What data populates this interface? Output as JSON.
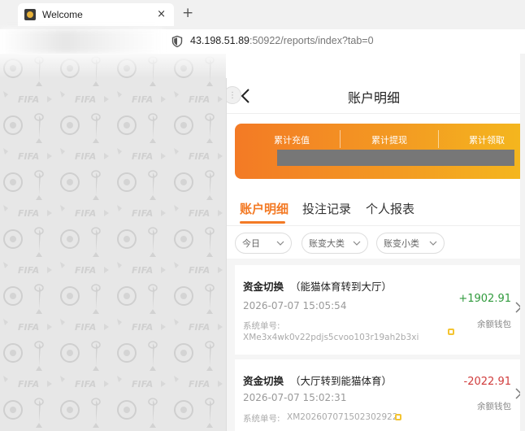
{
  "browser": {
    "tab_title": "Welcome",
    "close_glyph": "×",
    "new_tab_glyph": "+",
    "url_host": "43.198.51.89",
    "url_rest": ":50922/reports/index?tab=0"
  },
  "header": {
    "back_glyph": "<",
    "title": "账户明细"
  },
  "summary": {
    "stats": [
      "累计充值",
      "累计提现",
      "累计领取"
    ]
  },
  "tabs": [
    "账户明细",
    "投注记录",
    "个人报表"
  ],
  "filters": [
    "今日",
    "账变大类",
    "账变小类"
  ],
  "records": [
    {
      "title": "资金切换",
      "detail": "（能猫体育转到大厅）",
      "time": "2026-07-07 15:05:54",
      "no_label": "系统单号:",
      "no": "XMe3x4wk0v22pdjs5cvoo103r19ah2b3xi",
      "amount": "+1902.91",
      "wallet": "余额钱包"
    },
    {
      "title": "资金切换",
      "detail": "（大厅转到能猫体育）",
      "time": "2026-07-07 15:02:31",
      "no_label": "系统单号:",
      "no": "XM202607071502302922",
      "amount": "-2022.91",
      "wallet": "余额钱包"
    }
  ],
  "colors": {
    "accent": "#f37a25",
    "positive": "#2f9a3c",
    "negative": "#d03b3b"
  }
}
